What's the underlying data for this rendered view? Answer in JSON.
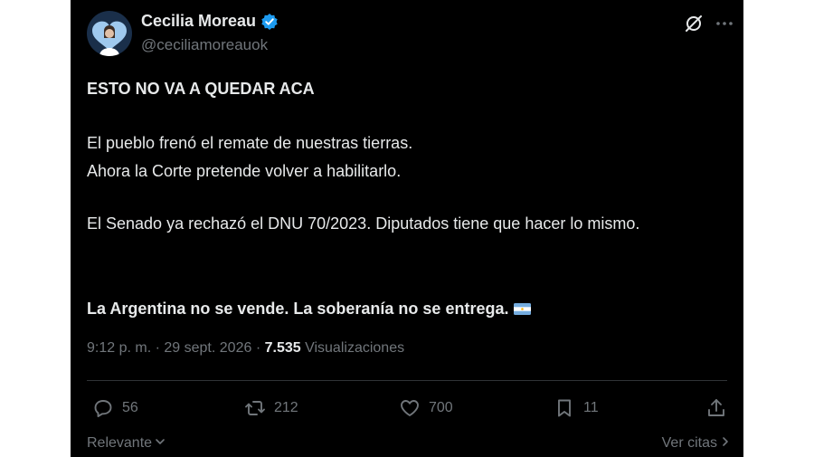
{
  "author": {
    "display_name": "Cecilia Moreau",
    "handle": "@ceciliamoreauok",
    "verified": true
  },
  "tweet": {
    "line1": "ESTO NO VA A QUEDAR ACA",
    "line2": "El pueblo frenó el remate de nuestras tierras.",
    "line3": "Ahora la Corte pretende volver a habilitarlo.",
    "line4": "El Senado ya rechazó el DNU 70/2023. Diputados tiene que hacer lo mismo.",
    "line5": "La Argentina no se vende. La soberanía no se entrega."
  },
  "meta": {
    "time": "9:12 p. m.",
    "separator": "·",
    "date": "29 sept. 2026",
    "views_count": "7.535",
    "views_label": "Visualizaciones"
  },
  "actions": {
    "replies": "56",
    "reposts": "212",
    "likes": "700",
    "bookmarks": "11"
  },
  "footer": {
    "sort_label": "Relevante",
    "quotes_label": "Ver citas"
  },
  "colors": {
    "background": "#000000",
    "text": "#e7e9ea",
    "muted": "#71767b",
    "verified": "#1d9bf0",
    "divider": "#2f3336"
  },
  "icons": [
    "verified-badge-icon",
    "grok-icon",
    "more-icon",
    "reply-icon",
    "repost-icon",
    "like-icon",
    "bookmark-icon",
    "share-icon",
    "chevron-down-icon",
    "chevron-right-icon",
    "argentina-flag-icon"
  ]
}
